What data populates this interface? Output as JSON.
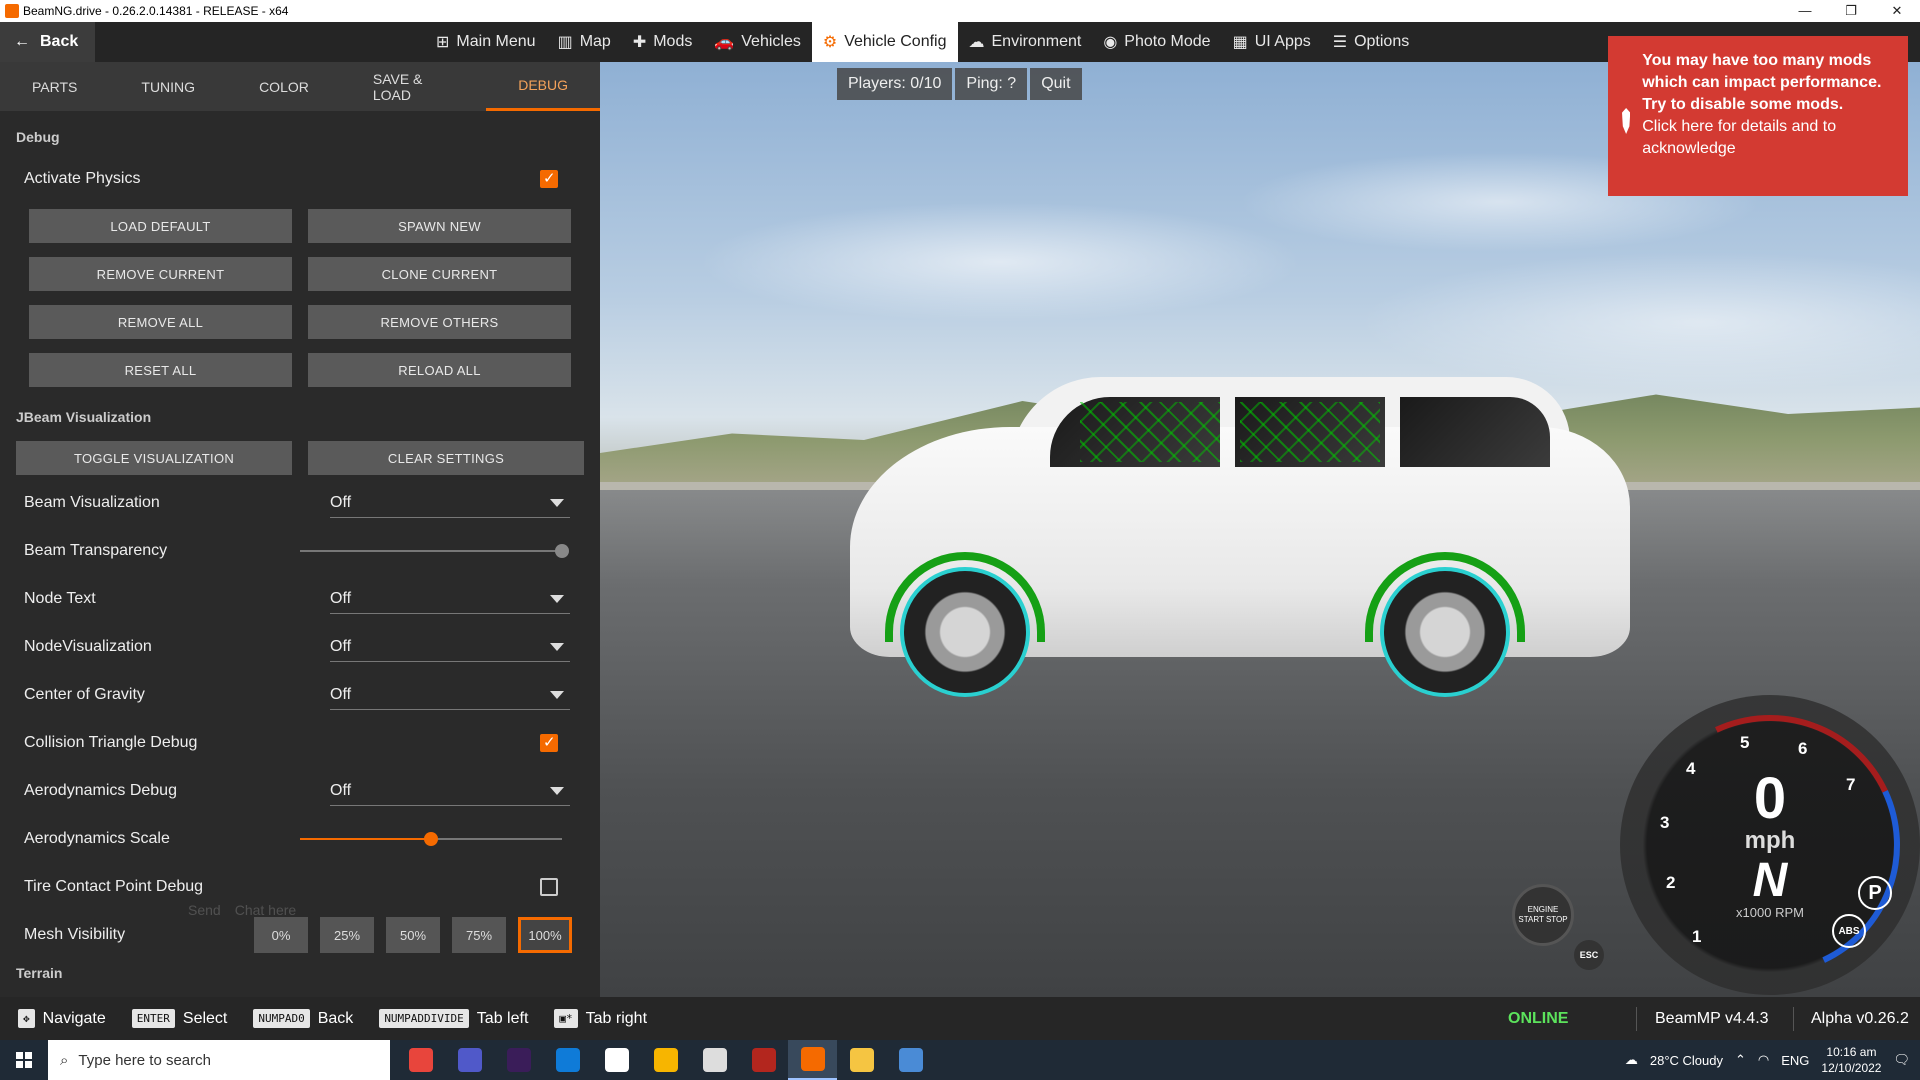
{
  "window": {
    "title": "BeamNG.drive - 0.26.2.0.14381 - RELEASE - x64",
    "minimize": "—",
    "restore": "❐",
    "close": "✕"
  },
  "topnav": {
    "back_label": "Back",
    "items": [
      {
        "label": "Main Menu",
        "icon": "⊞"
      },
      {
        "label": "Map",
        "icon": "▥"
      },
      {
        "label": "Mods",
        "icon": "✚"
      },
      {
        "label": "Vehicles",
        "icon": "🚗"
      },
      {
        "label": "Vehicle Config",
        "icon": "⚙",
        "active": true
      },
      {
        "label": "Environment",
        "icon": "☁"
      },
      {
        "label": "Photo Mode",
        "icon": "◉"
      },
      {
        "label": "UI Apps",
        "icon": "▦"
      },
      {
        "label": "Options",
        "icon": "☰"
      }
    ]
  },
  "server": {
    "players": "Players: 0/10",
    "ping": "Ping: ?",
    "quit": "Quit"
  },
  "tabs": [
    "PARTS",
    "TUNING",
    "COLOR",
    "SAVE & LOAD",
    "DEBUG"
  ],
  "debug": {
    "title": "Debug",
    "activate_physics": {
      "label": "Activate Physics",
      "checked": true
    },
    "buttons": [
      "LOAD DEFAULT",
      "SPAWN NEW",
      "REMOVE CURRENT",
      "CLONE CURRENT",
      "REMOVE ALL",
      "REMOVE OTHERS",
      "RESET ALL",
      "RELOAD ALL"
    ]
  },
  "jbeam": {
    "title": "JBeam Visualization",
    "toggle_label": "TOGGLE VISUALIZATION",
    "clear_label": "CLEAR SETTINGS",
    "beam_visualization": {
      "label": "Beam Visualization",
      "value": "Off"
    },
    "beam_transparency": {
      "label": "Beam Transparency",
      "level": 1.0
    },
    "node_text": {
      "label": "Node Text",
      "value": "Off"
    },
    "node_visualization": {
      "label": "NodeVisualization",
      "value": "Off"
    },
    "center_of_gravity": {
      "label": "Center of Gravity",
      "value": "Off"
    },
    "collision_triangle": {
      "label": "Collision Triangle Debug",
      "checked": true
    },
    "aero_debug": {
      "label": "Aerodynamics Debug",
      "value": "Off"
    },
    "aero_scale": {
      "label": "Aerodynamics Scale",
      "level": 0.5
    },
    "tire_contact": {
      "label": "Tire Contact Point Debug",
      "checked": false
    },
    "mesh_visibility": {
      "label": "Mesh Visibility",
      "options": [
        "0%",
        "25%",
        "50%",
        "75%",
        "100%"
      ],
      "selected": "100%"
    },
    "next_section": "Terrain"
  },
  "chat": {
    "send": "Send",
    "placeholder": "Chat here"
  },
  "notification": {
    "message": "You may have too many mods which can impact performance. Try to disable some mods.",
    "action": "Click here for details and to acknowledge"
  },
  "hints": [
    {
      "key": "✥",
      "label": "Navigate"
    },
    {
      "key": "ENTER",
      "label": "Select"
    },
    {
      "key": "NUMPAD0",
      "label": "Back"
    },
    {
      "key": "NUMPADDIVIDE",
      "label": "Tab left"
    },
    {
      "key": "▣*",
      "label": "Tab right"
    }
  ],
  "status": {
    "online": "ONLINE",
    "beammp": "BeamMP v4.4.3",
    "alpha": "Alpha v0.26.2"
  },
  "gauge": {
    "speed": "0",
    "unit": "mph",
    "gear": "N",
    "rpm_label": "x1000 RPM",
    "ticks": [
      "1",
      "2",
      "3",
      "4",
      "5",
      "6",
      "7"
    ],
    "engine_label": "ENGINE START STOP",
    "esc_label": "ESC",
    "park_label": "P",
    "abs_label": "ABS"
  },
  "taskbar": {
    "search_placeholder": "Type here to search",
    "weather": "28°C  Cloudy",
    "lang": "ENG",
    "time": "10:16 am",
    "date": "12/10/2022",
    "app_colors": [
      "#e8453c",
      "#5059c9",
      "#3a1d59",
      "#0f7bd8",
      "#ffffff",
      "#f7b500",
      "#dddddd",
      "#b3261e",
      "#f56a00",
      "#f5c542",
      "#4a8bd6"
    ]
  }
}
